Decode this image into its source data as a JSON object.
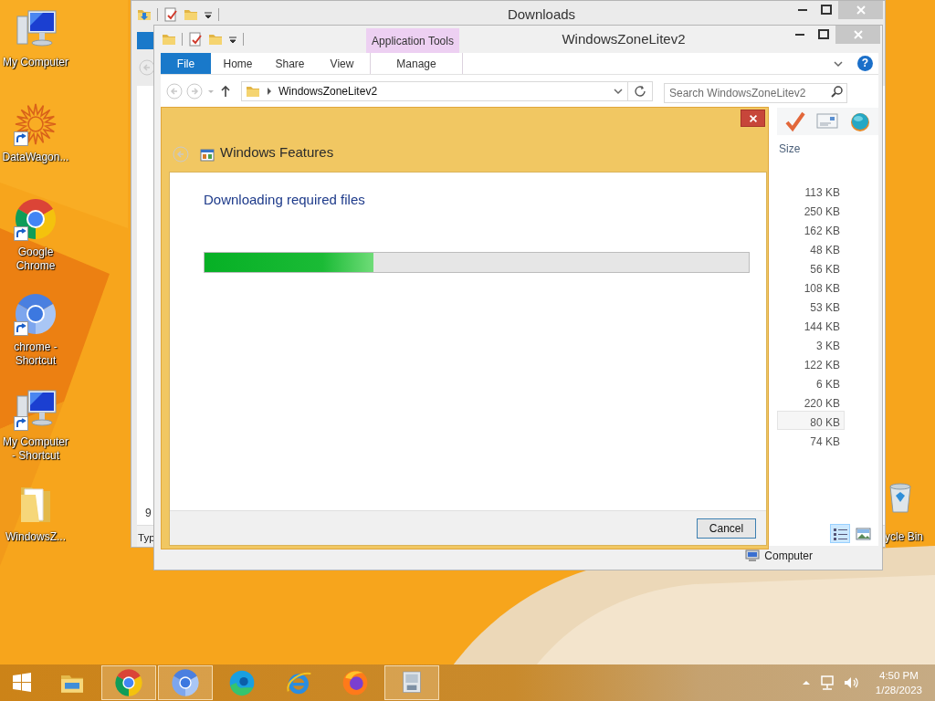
{
  "desktop_icons": [
    {
      "label": "My Computer",
      "kind": "computer",
      "shortcut": false
    },
    {
      "label": "DataWagon...",
      "kind": "star",
      "shortcut": true
    },
    {
      "label": "Google Chrome",
      "kind": "chrome",
      "shortcut": true
    },
    {
      "label": "chrome - Shortcut",
      "kind": "chromium",
      "shortcut": true
    },
    {
      "label": "My Computer - Shortcut",
      "kind": "computer",
      "shortcut": true
    },
    {
      "label": "WindowsZ...",
      "kind": "folder",
      "shortcut": false
    }
  ],
  "recycle_bin": {
    "label": "ycle Bin"
  },
  "downloads_window": {
    "title": "Downloads",
    "cell_text": "9",
    "column_header": "Typ"
  },
  "explorer_window": {
    "title": "WindowsZoneLitev2",
    "context_group": "Application Tools",
    "ribbon_tabs": [
      {
        "label": "File",
        "kind": "file"
      },
      {
        "label": "Home",
        "kind": "tab"
      },
      {
        "label": "Share",
        "kind": "tab"
      },
      {
        "label": "View",
        "kind": "tab"
      },
      {
        "label": "Manage",
        "kind": "context"
      }
    ],
    "help_button": "?",
    "address": "WindowsZoneLitev2",
    "search": {
      "placeholder": "Search WindowsZoneLitev2"
    },
    "size_column": "Size",
    "sizes": [
      {
        "text": "113 KB",
        "selected": false
      },
      {
        "text": "250 KB",
        "selected": false
      },
      {
        "text": "162 KB",
        "selected": false
      },
      {
        "text": "48 KB",
        "selected": false
      },
      {
        "text": "56 KB",
        "selected": false
      },
      {
        "text": "108 KB",
        "selected": false
      },
      {
        "text": "53 KB",
        "selected": false
      },
      {
        "text": "144 KB",
        "selected": false
      },
      {
        "text": "3 KB",
        "selected": false
      },
      {
        "text": "122 KB",
        "selected": false
      },
      {
        "text": "6 KB",
        "selected": false
      },
      {
        "text": "220 KB",
        "selected": false
      },
      {
        "text": "80 KB",
        "selected": true
      },
      {
        "text": "74 KB",
        "selected": false
      }
    ],
    "view_modes": [
      {
        "kind": "details",
        "selected": true
      },
      {
        "kind": "thumbnails",
        "selected": false
      }
    ],
    "status": "Computer"
  },
  "dialog": {
    "title": "Windows Features",
    "heading": "Downloading required files",
    "progress": {
      "level": 0.31
    },
    "buttons": [
      "Cancel"
    ]
  },
  "taskbar": {
    "apps": [
      {
        "kind": "explorer",
        "running": false
      },
      {
        "kind": "chrome",
        "running": true
      },
      {
        "kind": "chromium",
        "running": true
      },
      {
        "kind": "edge",
        "running": false
      },
      {
        "kind": "ie",
        "running": false
      },
      {
        "kind": "firefox",
        "running": false
      },
      {
        "kind": "installer",
        "running": true
      }
    ],
    "time": "4:50 PM",
    "date": "1/28/2023"
  }
}
